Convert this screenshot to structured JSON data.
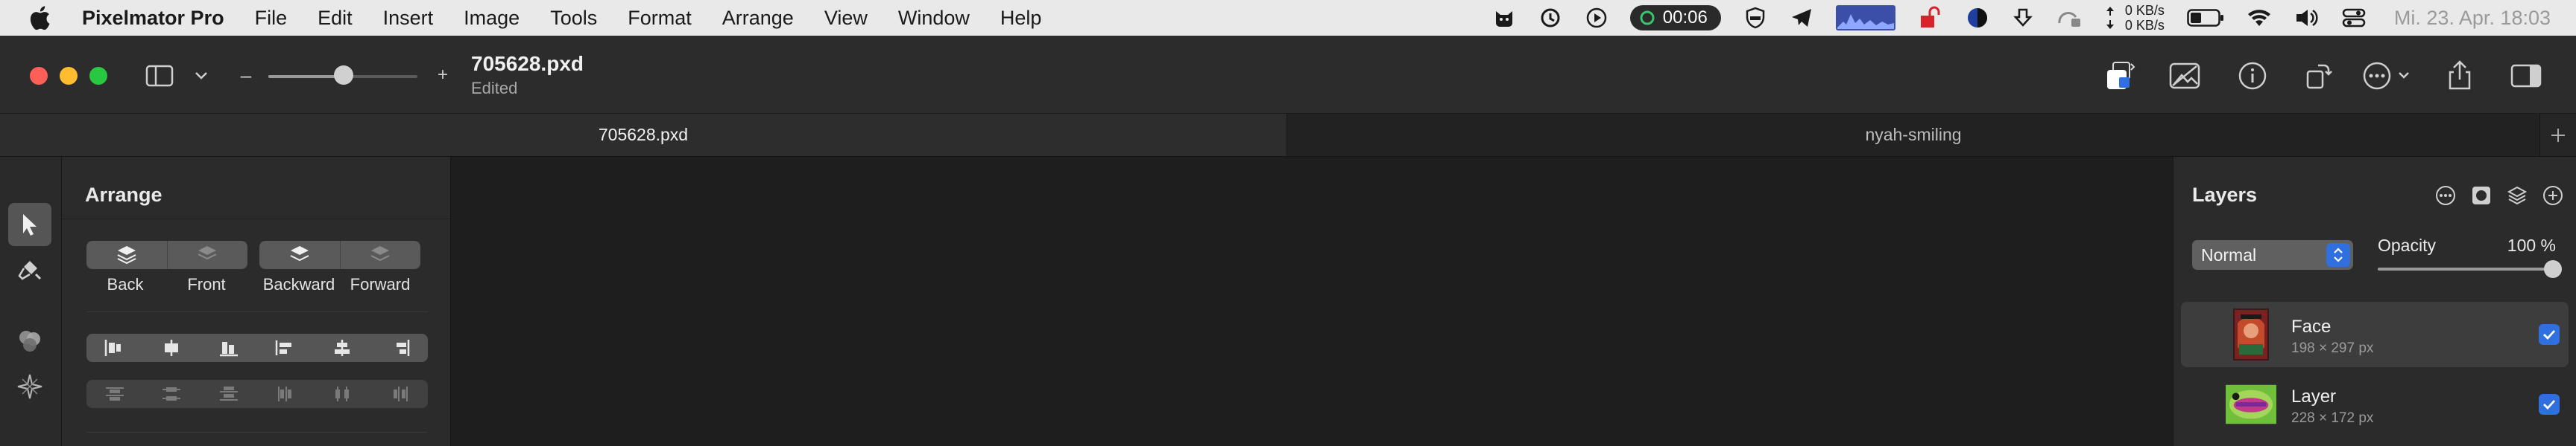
{
  "menubar": {
    "app_name": "Pixelmator Pro",
    "items": [
      "File",
      "Edit",
      "Insert",
      "Image",
      "Tools",
      "Format",
      "Arrange",
      "View",
      "Window",
      "Help"
    ],
    "timer": "00:06",
    "net_up": "0 KB/s",
    "net_down": "0 KB/s",
    "datetime": "Mi. 23. Apr.  18:03"
  },
  "toolbar": {
    "doc_title": "705628.pxd",
    "doc_status": "Edited",
    "zoom_out": "–",
    "zoom_in": "+",
    "zoom_level": 0.5
  },
  "tabs": [
    {
      "label": "705628.pxd",
      "active": true
    },
    {
      "label": "nyah-smiling",
      "active": false
    }
  ],
  "arrange": {
    "title": "Arrange",
    "order_buttons": [
      "Back",
      "Front",
      "Backward",
      "Forward"
    ]
  },
  "layers": {
    "title": "Layers",
    "blend_mode": "Normal",
    "opacity_label": "Opacity",
    "opacity_value": "100 %",
    "opacity_fraction": 1.0,
    "items": [
      {
        "name": "Face",
        "size": "198 × 297 px",
        "visible": true,
        "selected": true
      },
      {
        "name": "Layer",
        "size": "228 × 172 px",
        "visible": true,
        "selected": false
      }
    ]
  },
  "colors": {
    "accent": "#2f6fe0",
    "close": "#fe5f57",
    "minimize": "#febc2e",
    "zoom": "#28c840"
  }
}
